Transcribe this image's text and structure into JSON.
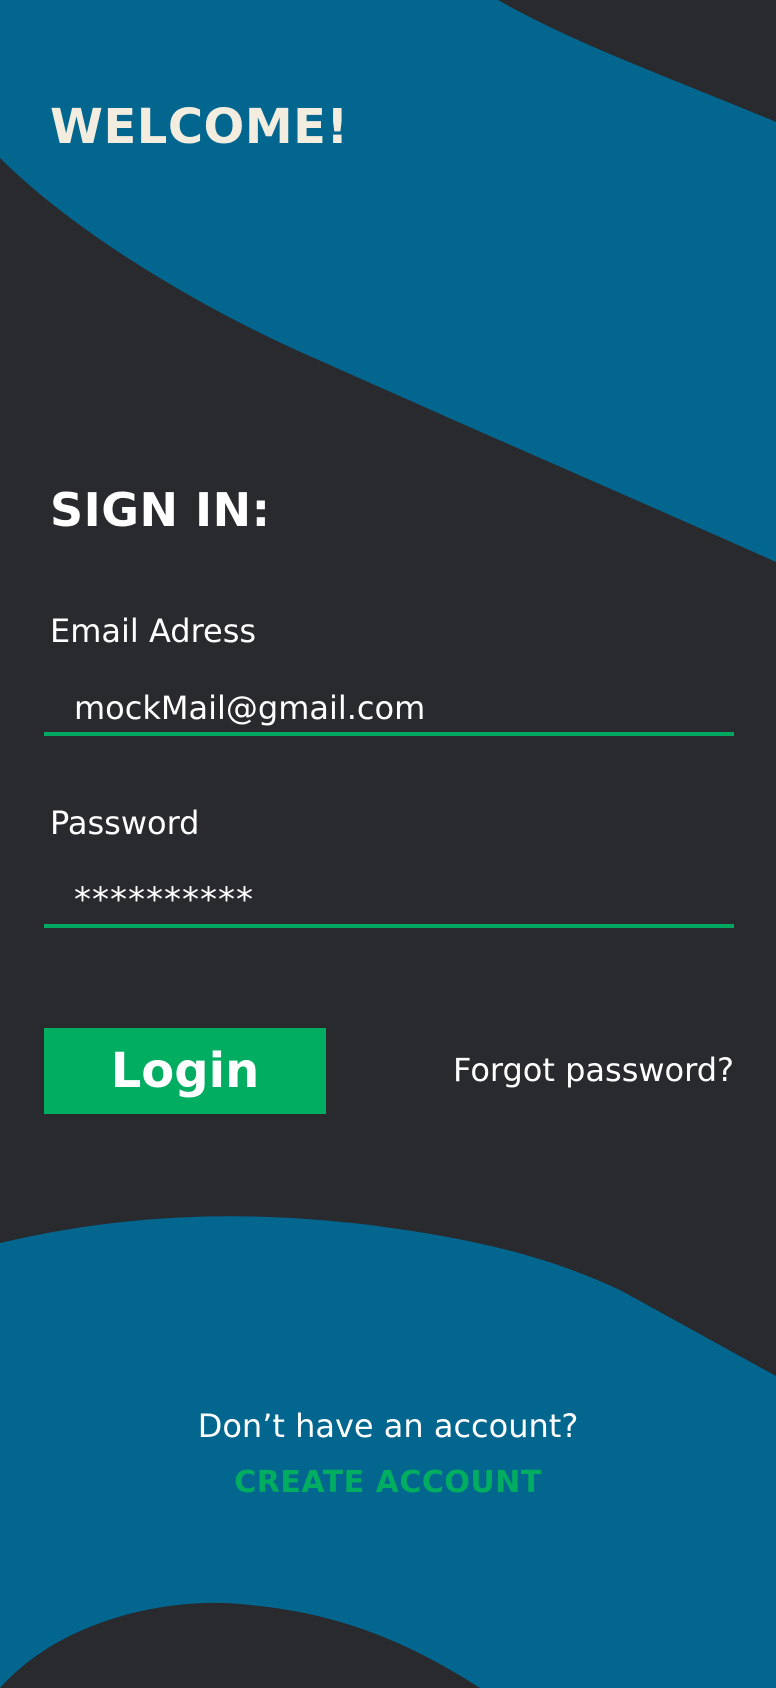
{
  "header": {
    "welcome": "WELCOME!"
  },
  "signin": {
    "title": "SIGN IN:",
    "email": {
      "label": "Email Adress",
      "value": "mockMail@gmail.com"
    },
    "password": {
      "label": "Password",
      "value": "**********"
    },
    "login_label": "Login",
    "forgot_label": "Forgot password?"
  },
  "footer": {
    "question": "Don’t have an account?",
    "create_label": "CREATE ACCOUNT"
  },
  "colors": {
    "background": "#282a2e",
    "accent_blue": "#03668f",
    "accent_green": "#00ad61",
    "welcome_text": "#f3ede0"
  }
}
